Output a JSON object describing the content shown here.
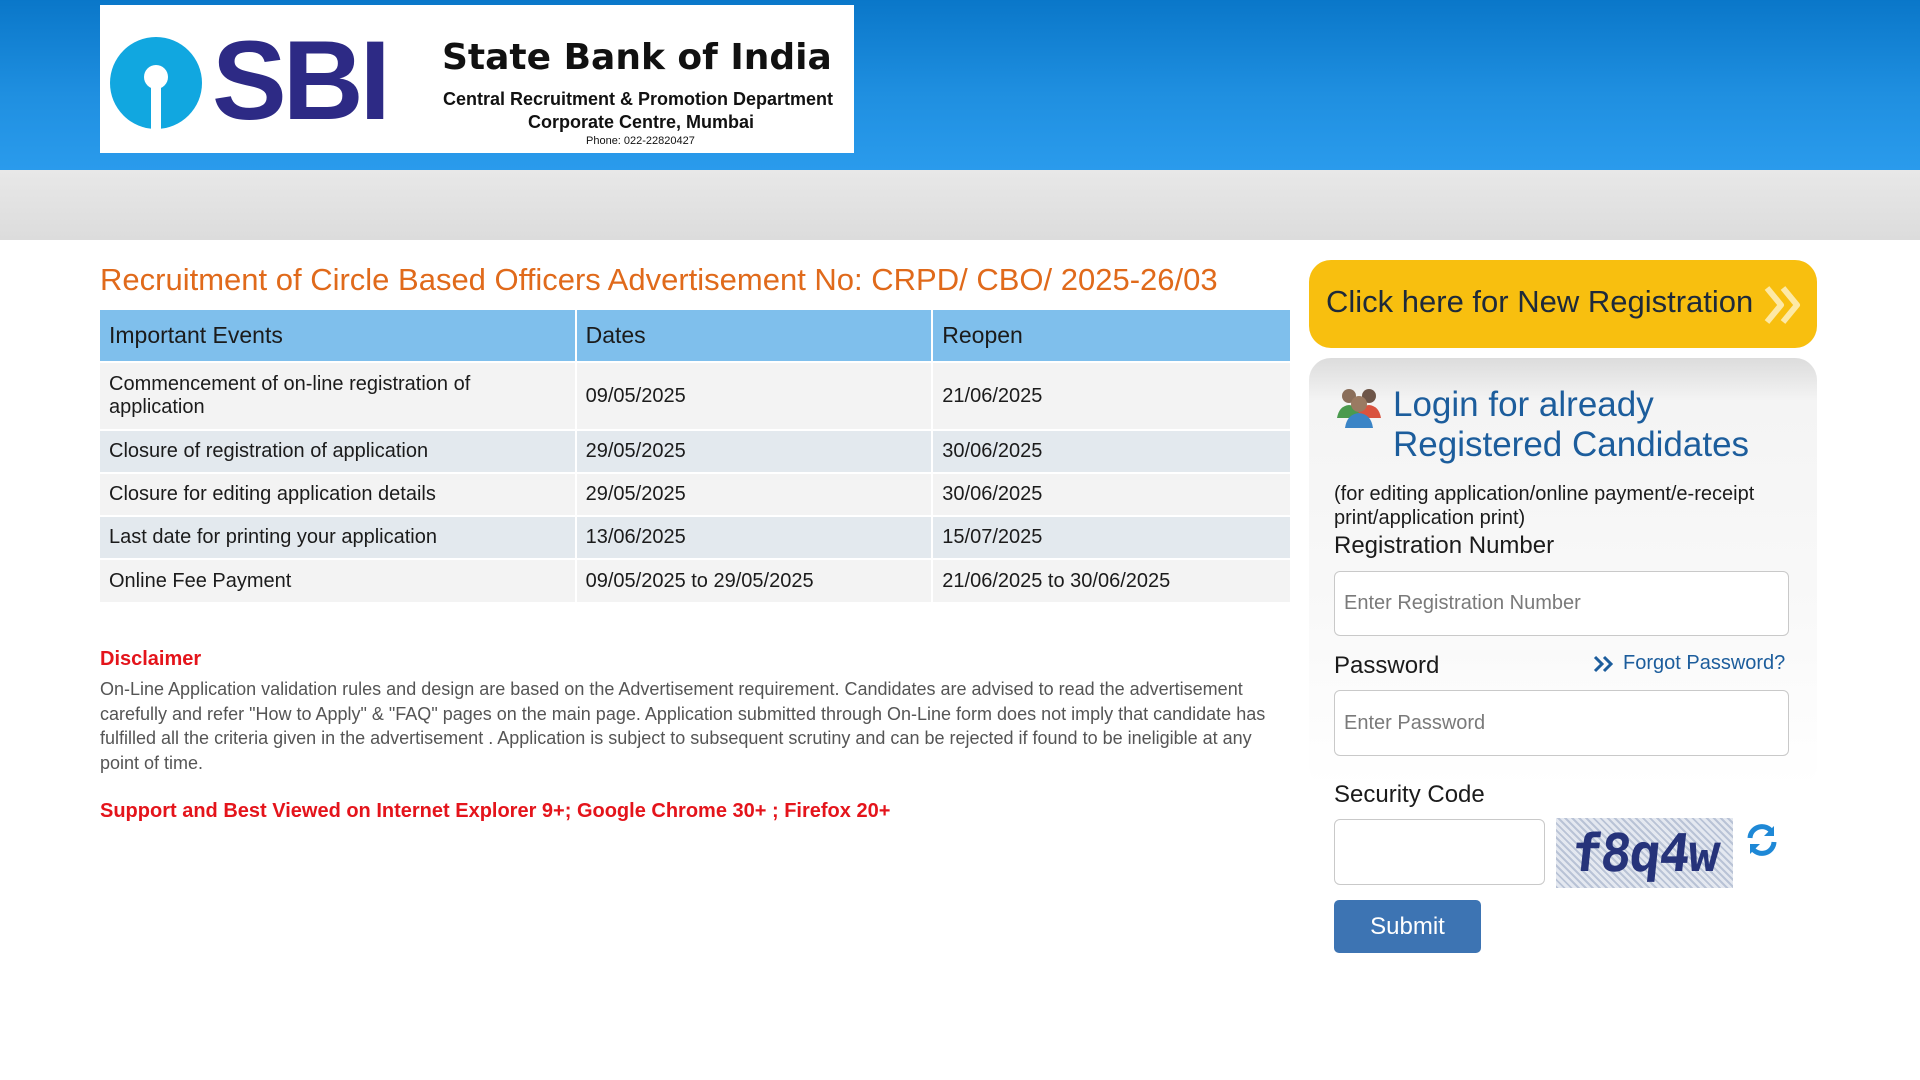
{
  "header": {
    "logo_text": "SBI",
    "bank_name": "State Bank of India",
    "department": "Central Recruitment & Promotion Department",
    "location": "Corporate Centre, Mumbai",
    "phone": "Phone: 022-22820427"
  },
  "main": {
    "title": "Recruitment of Circle Based Officers Advertisement No: CRPD/ CBO/ 2025-26/03",
    "table": {
      "headers": [
        "Important Events",
        "Dates",
        "Reopen"
      ],
      "rows": [
        [
          "Commencement of on-line registration of application",
          "09/05/2025",
          "21/06/2025"
        ],
        [
          "Closure of registration of application",
          "29/05/2025",
          "30/06/2025"
        ],
        [
          "Closure for editing application details",
          "29/05/2025",
          "30/06/2025"
        ],
        [
          "Last date for printing your application",
          "13/06/2025",
          "15/07/2025"
        ],
        [
          "Online Fee Payment",
          "09/05/2025 to 29/05/2025",
          "21/06/2025 to 30/06/2025"
        ]
      ]
    },
    "disclaimer": {
      "title": "Disclaimer",
      "text": "On-Line Application validation rules and design are based on the Advertisement requirement. Candidates are advised to read the advertisement carefully and refer \"How to Apply\" & \"FAQ\" pages on the main page. Application submitted through On-Line form does not imply that candidate has fulfilled all the criteria given in the advertisement . Application is subject to subsequent scrutiny and can be rejected if found to be ineligible at any point of time."
    },
    "support_note": "Support and Best Viewed on Internet Explorer 9+; Google Chrome 30+ ; Firefox 20+"
  },
  "sidebar": {
    "new_registration": "Click here for New Registration",
    "login_title": "Login for already Registered Candidates",
    "login_subtitle": "(for editing application/online payment/e-receipt print/application print)",
    "reg_label": "Registration Number",
    "reg_placeholder": "Enter Registration Number",
    "password_label": "Password",
    "password_placeholder": "Enter Password",
    "forgot_password": "Forgot Password?",
    "security_label": "Security Code",
    "security_value": "",
    "captcha_text": "f8q4w",
    "submit_label": "Submit"
  },
  "colors": {
    "header_blue": "#1f8fe0",
    "title_orange": "#e06a1b",
    "table_header": "#7fbfec",
    "alert_red": "#e4141b",
    "registration_yellow": "#f8bf0f",
    "link_blue": "#1c5d9c",
    "button_blue": "#3d74b3"
  },
  "icons": [
    "sbi-keyhole-logo-icon",
    "double-chevron-right-icon",
    "users-icon",
    "forgot-chevron-icon",
    "refresh-icon"
  ]
}
